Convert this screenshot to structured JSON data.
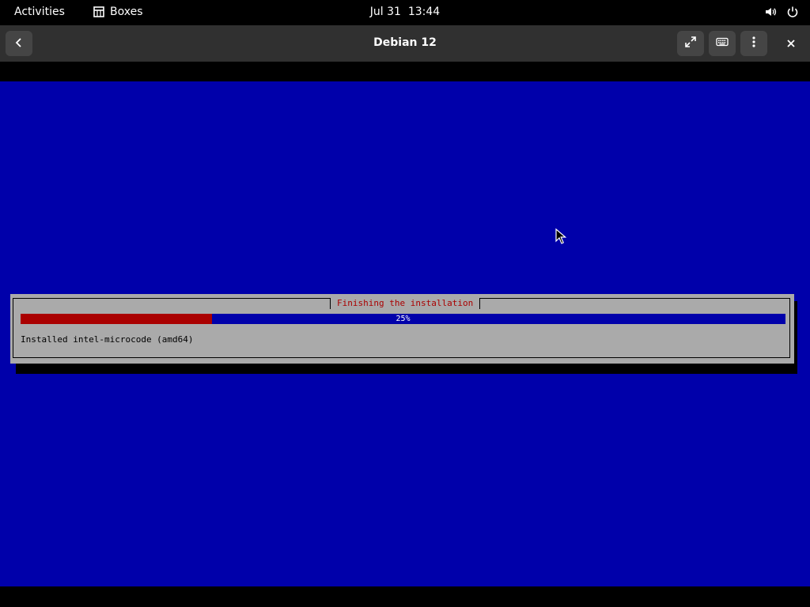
{
  "topbar": {
    "activities": "Activities",
    "app_name": "Boxes",
    "app_icon": "boxes-icon",
    "clock": "Jul 31  13:44",
    "icons": [
      "volume-icon",
      "power-icon"
    ]
  },
  "header": {
    "title": "Debian 12",
    "icons": [
      "back-icon",
      "fullscreen-icon",
      "keyboard-icon",
      "menu-icon",
      "close-icon"
    ]
  },
  "installer": {
    "dialog_title": "Finishing the installation",
    "progress_fraction": 0.25,
    "progress_text": "25%",
    "status": "Installed intel-microcode (amd64)",
    "colors": {
      "screen": "#0000aa",
      "dialog": "#aaaaaa",
      "bar_fill": "#aa0000",
      "title_text": "#aa0000"
    }
  }
}
